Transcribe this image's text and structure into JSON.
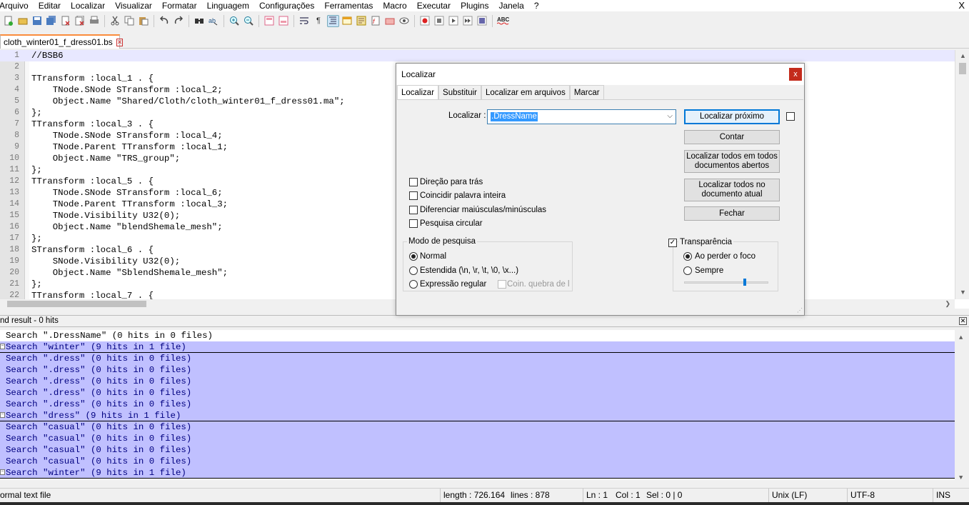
{
  "menubar": {
    "items": [
      "Arquivo",
      "Editar",
      "Localizar",
      "Visualizar",
      "Formatar",
      "Linguagem",
      "Configurações",
      "Ferramentas",
      "Macro",
      "Executar",
      "Plugins",
      "Janela",
      "?"
    ],
    "close": "X"
  },
  "tab": {
    "filename": "cloth_winter01_f_dress01.bs"
  },
  "editor": {
    "line_numbers": [
      "1",
      "2",
      "3",
      "4",
      "5",
      "6",
      "7",
      "8",
      "9",
      "10",
      "11",
      "12",
      "13",
      "14",
      "15",
      "16",
      "17",
      "18",
      "19",
      "20",
      "21",
      "22"
    ],
    "lines": [
      "//BSB6",
      "",
      "TTransform :local_1 . {",
      "    TNode.SNode STransform :local_2;",
      "    Object.Name \"Shared/Cloth/cloth_winter01_f_dress01.ma\";",
      "};",
      "TTransform :local_3 . {",
      "    TNode.SNode STransform :local_4;",
      "    TNode.Parent TTransform :local_1;",
      "    Object.Name \"TRS_group\";",
      "};",
      "TTransform :local_5 . {",
      "    TNode.SNode STransform :local_6;",
      "    TNode.Parent TTransform :local_3;",
      "    TNode.Visibility U32(0);",
      "    Object.Name \"blendShemale_mesh\";",
      "};",
      "STransform :local_6 . {",
      "    SNode.Visibility U32(0);",
      "    Object.Name \"SblendShemale_mesh\";",
      "};",
      "TTransform :local_7 . {"
    ]
  },
  "results_panel": {
    "title": "nd result - 0 hits",
    "close": "x",
    "lines": [
      "Search \".DressName\" (0 hits in 0 files)",
      "Search \"winter\" (9 hits in 1 file)",
      "Search \".dress\" (0 hits in 0 files)",
      "Search \".dress\" (0 hits in 0 files)",
      "Search \".dress\" (0 hits in 0 files)",
      "Search \".dress\" (0 hits in 0 files)",
      "Search \".dress\" (0 hits in 0 files)",
      "Search \"dress\" (9 hits in 1 file)",
      "Search \"casual\" (0 hits in 0 files)",
      "Search \"casual\" (0 hits in 0 files)",
      "Search \"casual\" (0 hits in 0 files)",
      "Search \"casual\" (0 hits in 0 files)",
      "Search \"winter\" (9 hits in 1 file)"
    ]
  },
  "statusbar": {
    "filetype": "ormal text file",
    "length": "length : 726.164",
    "lines": "lines : 878",
    "ln": "Ln : 1",
    "col": "Col : 1",
    "sel": "Sel : 0 | 0",
    "eol": "Unix (LF)",
    "encoding": "UTF-8",
    "mode": "INS"
  },
  "dialog": {
    "title": "Localizar",
    "close": "x",
    "tabs": [
      "Localizar",
      "Substituir",
      "Localizar em arquivos",
      "Marcar"
    ],
    "find_label": "Localizar :",
    "find_value": ".DressName",
    "buttons": {
      "find_next": "Localizar próximo",
      "count": "Contar",
      "find_all_open": "Localizar todos em todos documentos abertos",
      "find_all_current": "Localizar todos no documento atual",
      "close": "Fechar"
    },
    "options": [
      "Direção para trás",
      "Coincidir palavra inteira",
      "Diferenciar maiúsculas/minúsculas",
      "Pesquisa circular"
    ],
    "search_mode": {
      "title": "Modo de pesquisa",
      "normal": "Normal",
      "extended": "Estendida  (\\n, \\r, \\t, \\0, \\x...)",
      "regex": "Expressão regular",
      "newline": "Coin. quebra de lir"
    },
    "transparency": {
      "title": "Transparência",
      "on_lose_focus": "Ao perder o foco",
      "always": "Sempre",
      "level": 0.72
    }
  },
  "colors": {
    "accent": "#0078d7",
    "selection": "#c0c0ff",
    "result_text": "#000080",
    "tab_accent": "#fa8c3c"
  }
}
